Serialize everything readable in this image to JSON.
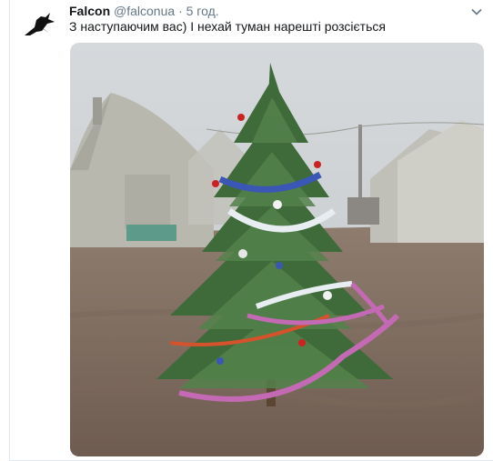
{
  "tweet": {
    "author_name": "Falcon",
    "author_handle": "@falconua",
    "separator": "·",
    "timestamp": "5 год.",
    "text": "З наступаючим вас) І нехай туман нарешті розсіється",
    "photo_alt": "Decorated Christmas tree in a foggy tent camp"
  },
  "icons": {
    "avatar": "falcon-bird-icon",
    "menu": "chevron-down-icon"
  },
  "colors": {
    "fog": "#c9cdd0",
    "ground": "#7d6a5e",
    "tree": "#3f6a3a",
    "tinsel_pink": "#c46ab4",
    "tinsel_blue": "#3a57b5",
    "tinsel_silver": "#e8edf2"
  }
}
